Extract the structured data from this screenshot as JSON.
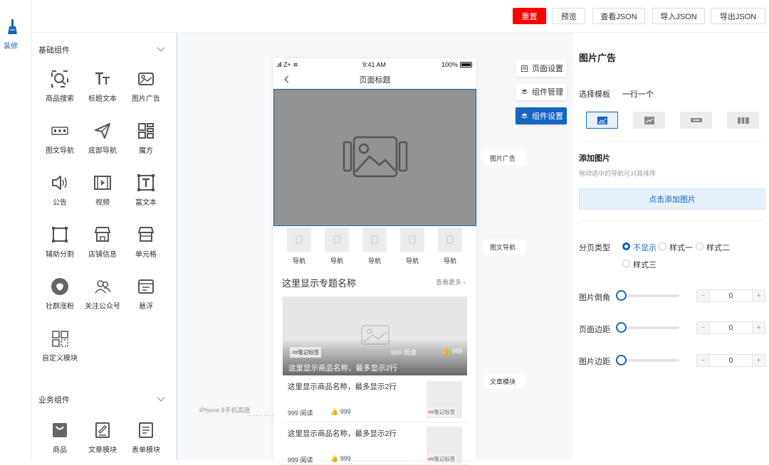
{
  "rail": {
    "label": "装修"
  },
  "toolbar": {
    "reset": "重置",
    "preview": "预览",
    "view_json": "查看JSON",
    "import_json": "导入JSON",
    "export_json": "导出JSON",
    "accent": "#ff0000"
  },
  "library": {
    "basic_title": "基础组件",
    "basic_items": [
      {
        "label": "商品搜索",
        "icon": "search-icon"
      },
      {
        "label": "标题文本",
        "icon": "title-text-icon"
      },
      {
        "label": "图片广告",
        "icon": "image-ad-icon"
      },
      {
        "label": "图文导航",
        "icon": "image-nav-icon"
      },
      {
        "label": "底部导航",
        "icon": "paper-plane-icon"
      },
      {
        "label": "魔方",
        "icon": "cube-grid-icon"
      },
      {
        "label": "公告",
        "icon": "speaker-icon"
      },
      {
        "label": "视频",
        "icon": "video-icon"
      },
      {
        "label": "富文本",
        "icon": "rich-text-icon"
      },
      {
        "label": "辅助分割",
        "icon": "divider-icon"
      },
      {
        "label": "店铺信息",
        "icon": "shop-icon"
      },
      {
        "label": "单元格",
        "icon": "cell-icon"
      },
      {
        "label": "社群涨粉",
        "icon": "community-icon"
      },
      {
        "label": "关注公众号",
        "icon": "follow-icon"
      },
      {
        "label": "悬浮",
        "icon": "float-icon"
      },
      {
        "label": "自定义模块",
        "icon": "custom-module-icon"
      }
    ],
    "biz_title": "业务组件",
    "biz_items": [
      {
        "label": "商品",
        "icon": "goods-icon"
      },
      {
        "label": "文章模块",
        "icon": "article-icon"
      },
      {
        "label": "表单模块",
        "icon": "form-icon"
      }
    ]
  },
  "canvas": {
    "height_hint": "iPhone 8手机高度",
    "phone": {
      "carrier": "Z+",
      "time": "9:41 AM",
      "battery": "100%",
      "title": "页面标题",
      "nav_items": [
        "导航",
        "导航",
        "导航",
        "导航",
        "导航"
      ],
      "topic_title": "这里显示专题名称",
      "see_more": "查看更多",
      "hero": {
        "tag": "#笔记标签",
        "reads": "999 阅读",
        "likes": "999",
        "title": "这里显示商品名称，最多显示2行"
      },
      "articles": [
        {
          "title": "这里显示商品名称，最多显示2行",
          "reads": "999 阅读",
          "likes": "999",
          "tag": "#笔记标签"
        },
        {
          "title": "这里显示商品名称，最多显示2行",
          "reads": "999 阅读",
          "likes": "999",
          "tag": "#笔记标签"
        }
      ]
    },
    "side_buttons": [
      "页面设置",
      "组件管理",
      "组件设置"
    ],
    "tags": [
      "图片广告",
      "图文导航",
      "文章模块"
    ]
  },
  "props": {
    "title": "图片广告",
    "template_label": "选择模板",
    "template_value": "一行一个",
    "add_title": "添加图片",
    "add_hint": "拖动选中的导航可对其排序",
    "add_button": "点击添加图片",
    "pager_label": "分页类型",
    "pager_options": [
      "不显示",
      "样式一",
      "样式二",
      "样式三"
    ],
    "pager_selected": 0,
    "corner_label": "图片倒角",
    "corner_value": "0",
    "page_margin_label": "页面边距",
    "page_margin_value": "0",
    "image_margin_label": "图片边距",
    "image_margin_value": "0"
  }
}
